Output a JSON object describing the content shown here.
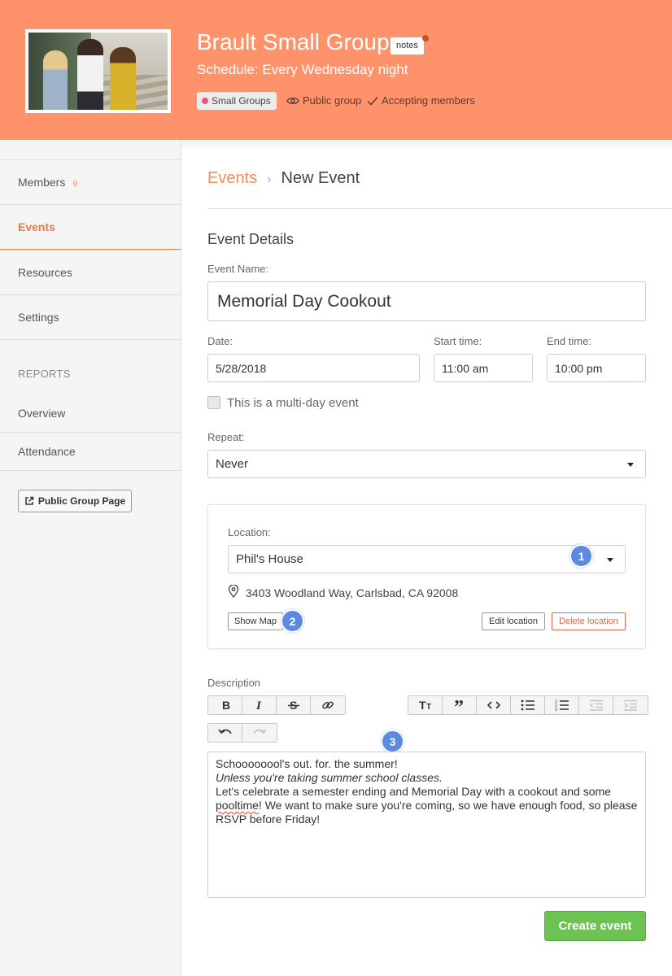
{
  "header": {
    "group_name": "Brault Small Group",
    "notes_badge": "notes",
    "schedule": "Schedule: Every Wednesday night",
    "tag": "Small Groups",
    "visibility": "Public group",
    "membership": "Accepting members",
    "colors": {
      "banner": "#fe926b",
      "tag_dot": "#e8557a",
      "notes_dot": "#d24f1f"
    }
  },
  "sidebar": {
    "items": [
      {
        "label": "Members",
        "count": "9"
      },
      {
        "label": "Events"
      },
      {
        "label": "Resources"
      },
      {
        "label": "Settings"
      }
    ],
    "active_item": "Events",
    "reports_heading": "REPORTS",
    "report_items": [
      {
        "label": "Overview"
      },
      {
        "label": "Attendance"
      }
    ],
    "public_page_button": "Public Group Page"
  },
  "breadcrumb": {
    "parent": "Events",
    "separator": "›",
    "current": "New Event"
  },
  "form": {
    "section_title": "Event Details",
    "event_name_label": "Event Name:",
    "event_name_value": "Memorial Day Cookout",
    "date_label": "Date:",
    "date_value": "5/28/2018",
    "start_label": "Start time:",
    "start_value": "11:00 am",
    "end_label": "End time:",
    "end_value": "10:00 pm",
    "multiday_label": "This is a multi-day event",
    "multiday_checked": false,
    "repeat_label": "Repeat:",
    "repeat_value": "Never",
    "location": {
      "label": "Location:",
      "value": "Phil's House",
      "address": "3403 Woodland Way, Carlsbad, CA 92008",
      "show_map": "Show Map",
      "edit": "Edit location",
      "delete": "Delete location"
    },
    "description": {
      "label": "Description",
      "line1": "Schoooooool's out. for. the summer!",
      "line2": "Unless you're taking summer school classes.",
      "line3_before": "Let's celebrate a semester ending and Memorial Day with a cookout and some ",
      "line3_misspelled": "pooltime",
      "line3_after": "! We want to make sure you're coming, so we have enough food, so please RSVP before Friday!"
    },
    "toolbar_icons": [
      "bold-icon",
      "italic-icon",
      "strikethrough-icon",
      "link-icon",
      "heading-icon",
      "quote-icon",
      "code-icon",
      "bullet-list-icon",
      "numbered-list-icon",
      "outdent-icon",
      "indent-icon",
      "undo-icon",
      "redo-icon"
    ],
    "submit": "Create event",
    "submit_color": "#6cc352"
  },
  "callouts": [
    "1",
    "2",
    "3"
  ]
}
